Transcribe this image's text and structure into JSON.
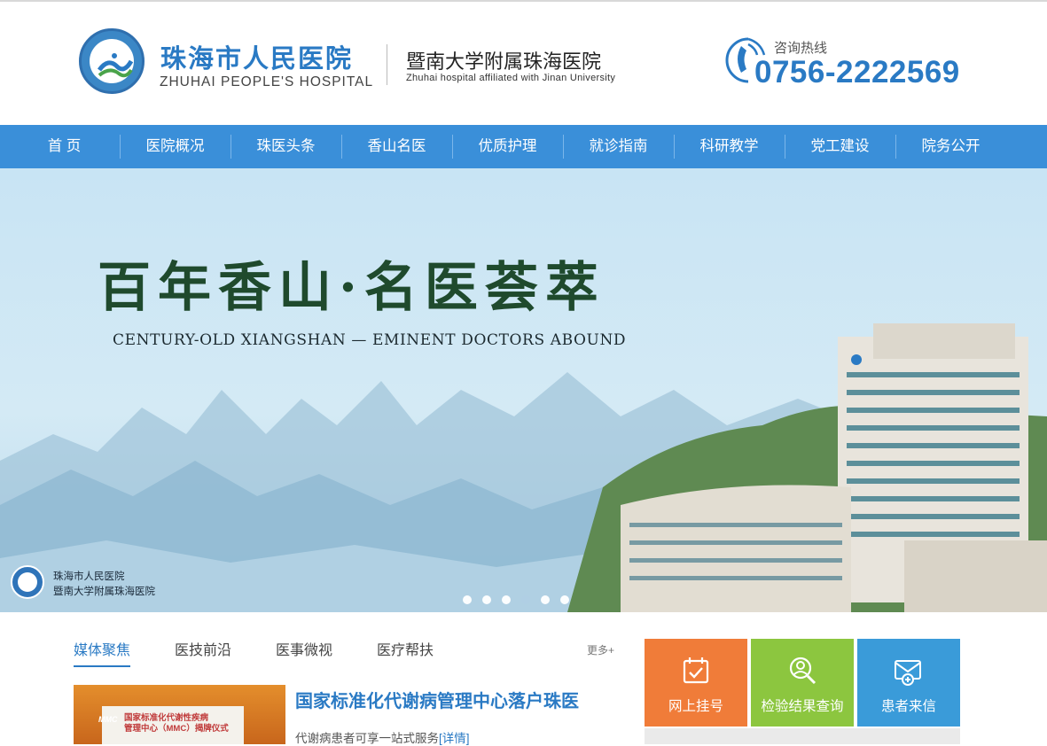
{
  "header": {
    "hospital_name_cn": "珠海市人民医院",
    "hospital_name_en": "ZHUHAI PEOPLE'S HOSPITAL",
    "affiliation_cn": "暨南大学附属珠海医院",
    "affiliation_en": "Zhuhai hospital affiliated with Jinan University",
    "hotline_label": "咨询热线",
    "hotline_number": "0756-2222569"
  },
  "nav": {
    "items": [
      "首 页",
      "医院概况",
      "珠医头条",
      "香山名医",
      "优质护理",
      "就诊指南",
      "科研教学",
      "党工建设",
      "院务公开"
    ]
  },
  "banner": {
    "title": "百年香山·名医荟萃",
    "subtitle": "CENTURY-OLD XIANGSHAN — EMINENT DOCTORS ABOUND",
    "logo_line1": "珠海市人民医院",
    "logo_line2": "暨南大学附属珠海医院",
    "slide_count": 6,
    "active_slide": 4
  },
  "news": {
    "tabs": [
      "媒体聚焦",
      "医技前沿",
      "医事微视",
      "医疗帮扶"
    ],
    "more_label": "更多+",
    "featured_title": "国家标准化代谢病管理中心落户珠医",
    "featured_desc": "代谢病患者可享一站式服务",
    "detail_link": "[详情]",
    "image_text_line1": "国家标准化代谢性疾病",
    "image_text_line2": "管理中心（MMC）揭牌仪式",
    "image_badge": "MMC"
  },
  "quick_links": {
    "items": [
      {
        "label": "网上挂号",
        "icon": "calendar-check-icon",
        "color": "#f07c39"
      },
      {
        "label": "检验结果查询",
        "icon": "doctor-search-icon",
        "color": "#8cc63f"
      },
      {
        "label": "患者来信",
        "icon": "envelope-plus-icon",
        "color": "#3a9bd9"
      }
    ]
  },
  "colors": {
    "brand_blue": "#2a7ac4",
    "nav_blue": "#3a8fd9"
  }
}
